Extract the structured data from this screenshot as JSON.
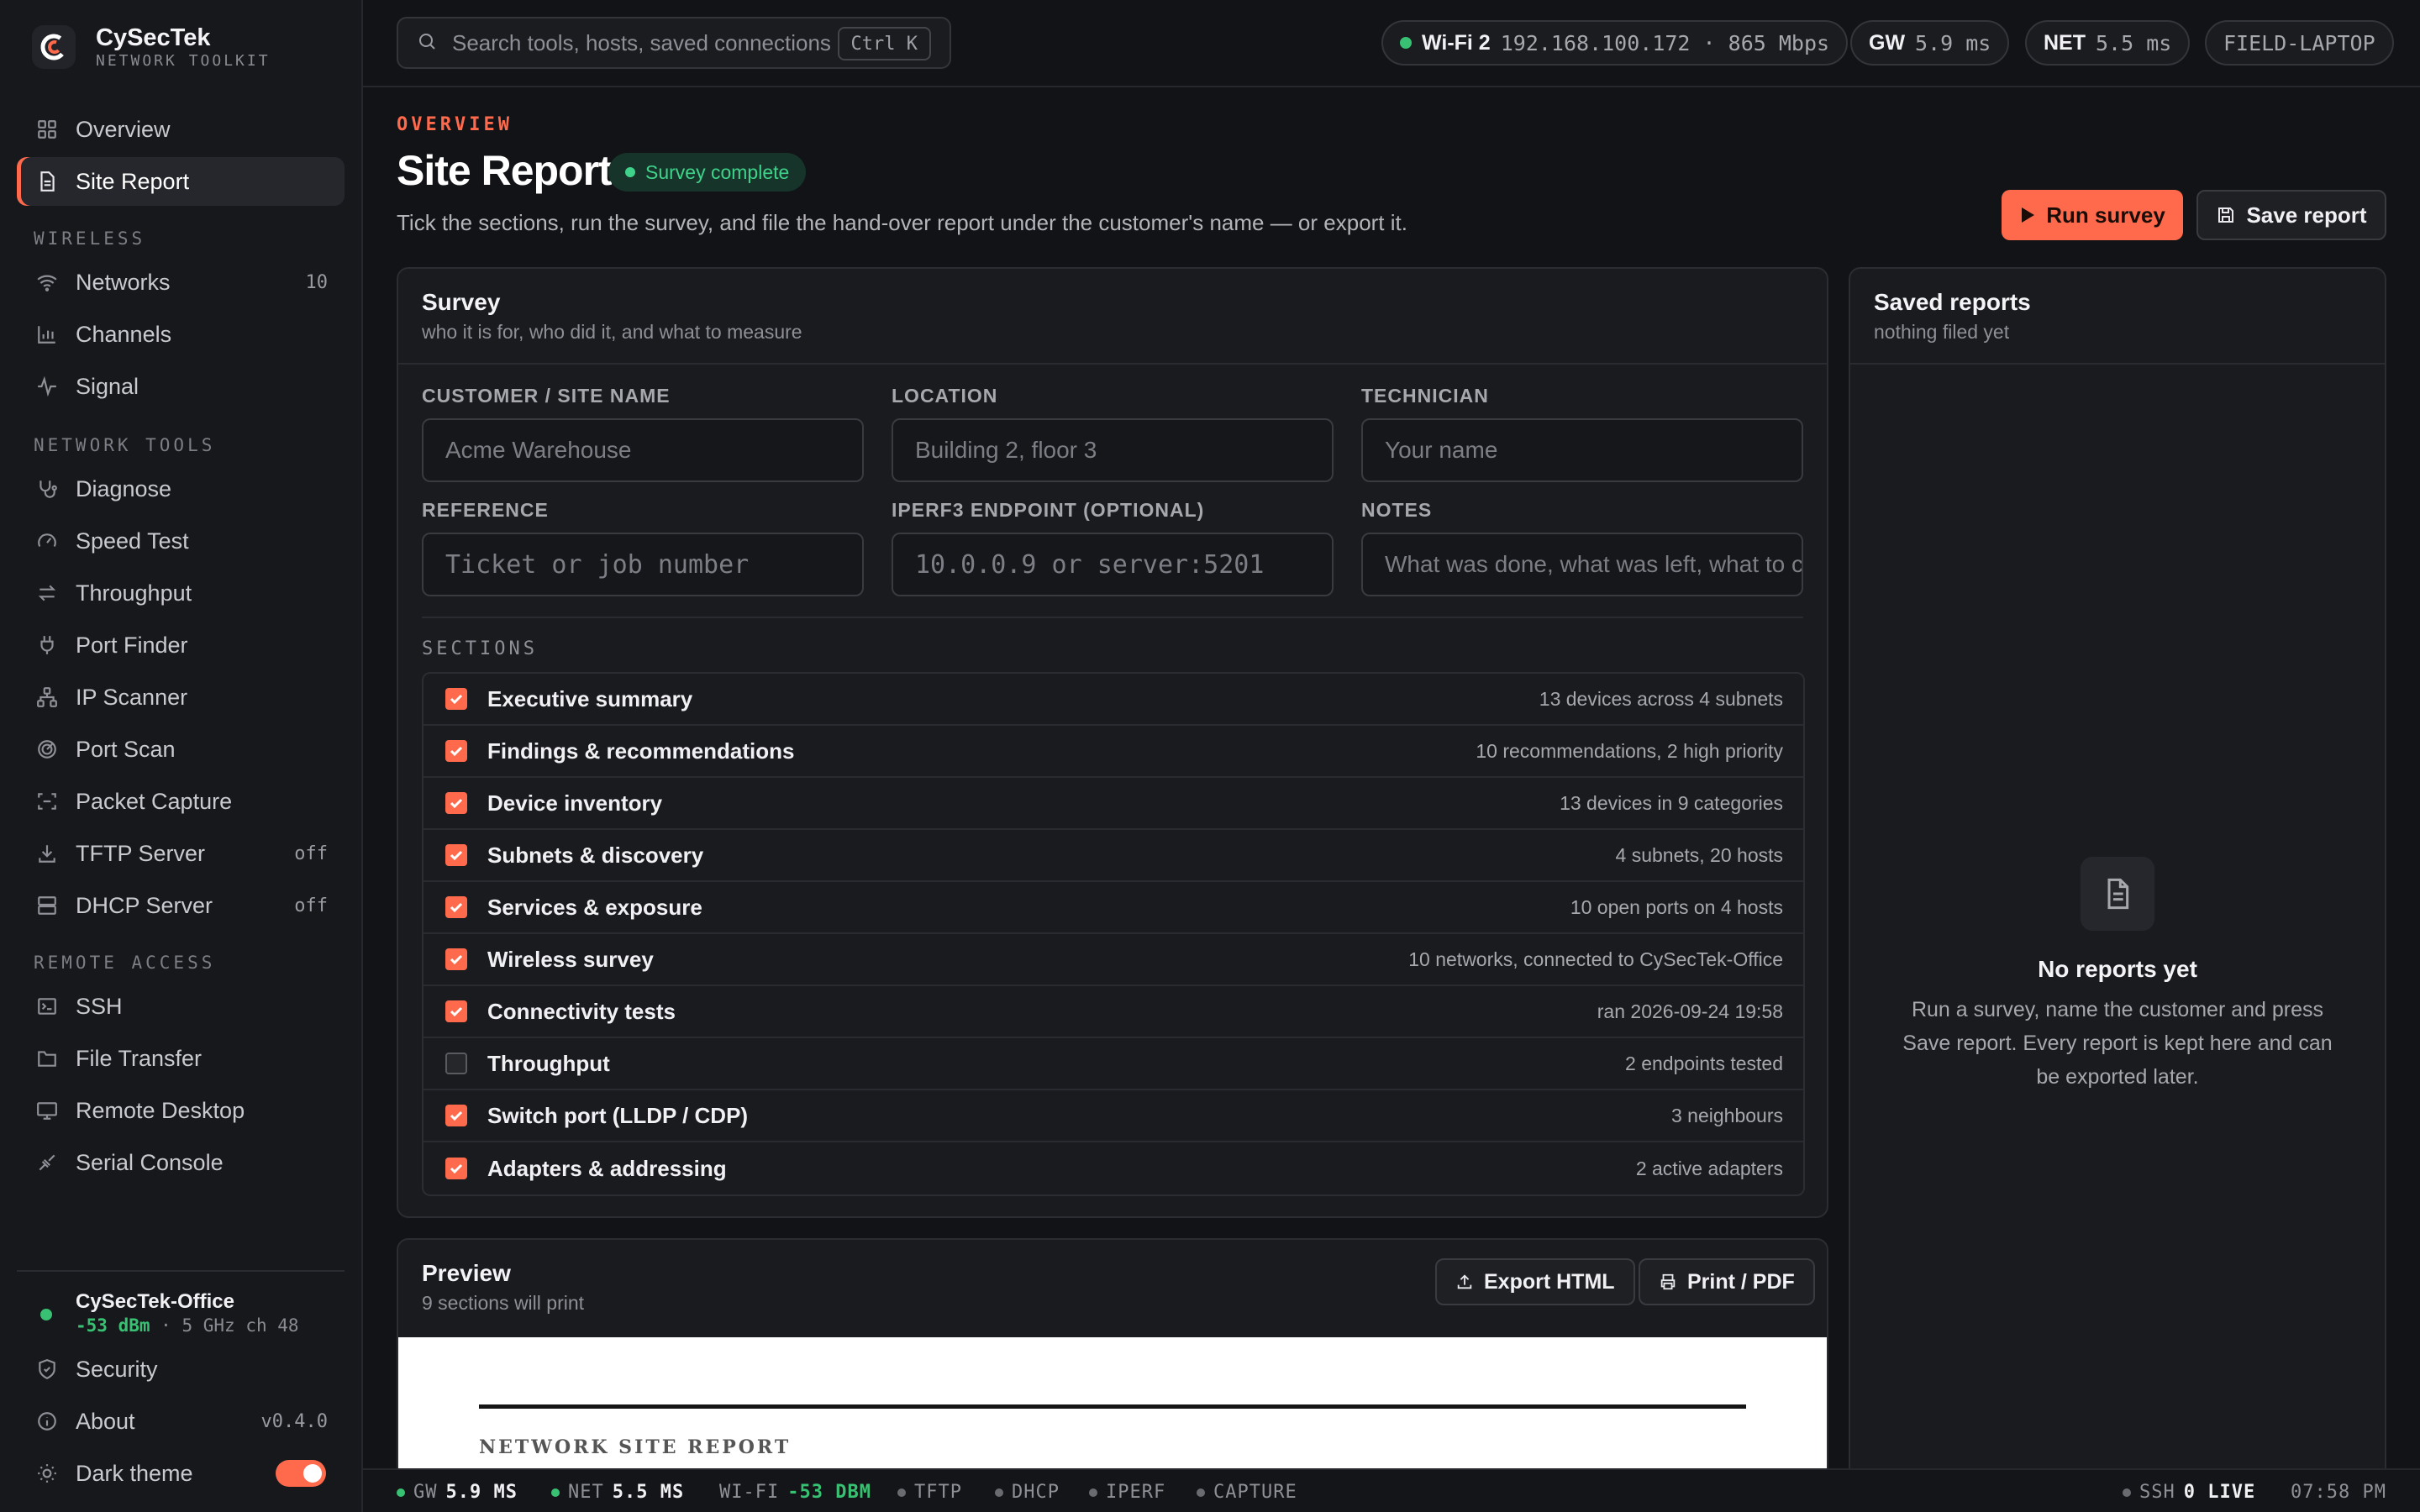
{
  "app": {
    "name": "CySecTek",
    "tagline": "NETWORK TOOLKIT"
  },
  "sidebar": {
    "items": [
      {
        "label": "Overview",
        "icon": "grid-icon"
      },
      {
        "label": "Site Report",
        "icon": "document-icon",
        "active": true
      }
    ],
    "sections": [
      {
        "title": "WIRELESS",
        "items": [
          {
            "label": "Networks",
            "icon": "wifi-icon",
            "badge": "10"
          },
          {
            "label": "Channels",
            "icon": "bar-chart-icon"
          },
          {
            "label": "Signal",
            "icon": "pulse-icon"
          }
        ]
      },
      {
        "title": "NETWORK TOOLS",
        "items": [
          {
            "label": "Diagnose",
            "icon": "stethoscope-icon"
          },
          {
            "label": "Speed Test",
            "icon": "gauge-icon"
          },
          {
            "label": "Throughput",
            "icon": "arrows-swap-icon"
          },
          {
            "label": "Port Finder",
            "icon": "plug-icon"
          },
          {
            "label": "IP Scanner",
            "icon": "network-icon"
          },
          {
            "label": "Port Scan",
            "icon": "radar-icon"
          },
          {
            "label": "Packet Capture",
            "icon": "capture-icon"
          },
          {
            "label": "TFTP Server",
            "icon": "download-icon",
            "badge": "off"
          },
          {
            "label": "DHCP Server",
            "icon": "server-icon",
            "badge": "off"
          }
        ]
      },
      {
        "title": "REMOTE ACCESS",
        "items": [
          {
            "label": "SSH",
            "icon": "terminal-icon"
          },
          {
            "label": "File Transfer",
            "icon": "folder-icon"
          },
          {
            "label": "Remote Desktop",
            "icon": "monitor-icon"
          },
          {
            "label": "Serial Console",
            "icon": "cable-icon"
          }
        ]
      }
    ],
    "connection": {
      "ssid": "CySecTek-Office",
      "signal": "-53 dBm",
      "band": "· 5 GHz ch 48"
    },
    "footer": [
      {
        "label": "Security",
        "icon": "shield-icon"
      },
      {
        "label": "About",
        "icon": "info-icon",
        "badge": "v0.4.0"
      },
      {
        "label": "Dark theme",
        "icon": "sun-icon",
        "toggle": true
      }
    ]
  },
  "topbar": {
    "search_placeholder": "Search tools, hosts, saved connections",
    "shortcut": "Ctrl K",
    "wifi": {
      "label": "Wi-Fi 2",
      "value": "192.168.100.172 · 865 Mbps"
    },
    "gw": {
      "label": "GW",
      "value": "5.9 ms"
    },
    "net": {
      "label": "NET",
      "value": "5.5 ms"
    },
    "host": "FIELD-LAPTOP"
  },
  "header": {
    "eyebrow": "OVERVIEW",
    "title": "Site Report",
    "badge": "Survey complete",
    "subtitle": "Tick the sections, run the survey, and file the hand-over report under the customer's name — or export it.",
    "run_label": "Run survey",
    "save_label": "Save report"
  },
  "survey": {
    "title": "Survey",
    "subtitle": "who it is for, who did it, and what to measure",
    "fields": {
      "customer": {
        "label": "CUSTOMER / SITE NAME",
        "placeholder": "Acme Warehouse"
      },
      "location": {
        "label": "LOCATION",
        "placeholder": "Building 2, floor 3"
      },
      "technician": {
        "label": "TECHNICIAN",
        "placeholder": "Your name"
      },
      "reference": {
        "label": "REFERENCE",
        "placeholder": "Ticket or job number"
      },
      "iperf": {
        "label": "IPERF3 ENDPOINT (OPTIONAL)",
        "placeholder": "10.0.0.9 or server:5201"
      },
      "notes": {
        "label": "NOTES",
        "placeholder": "What was done, what was left, what to chase"
      }
    },
    "sections_label": "SECTIONS",
    "sections": [
      {
        "name": "Executive summary",
        "meta": "13 devices across 4 subnets",
        "checked": true
      },
      {
        "name": "Findings & recommendations",
        "meta": "10 recommendations, 2 high priority",
        "checked": true
      },
      {
        "name": "Device inventory",
        "meta": "13 devices in 9 categories",
        "checked": true
      },
      {
        "name": "Subnets & discovery",
        "meta": "4 subnets, 20 hosts",
        "checked": true
      },
      {
        "name": "Services & exposure",
        "meta": "10 open ports on 4 hosts",
        "checked": true
      },
      {
        "name": "Wireless survey",
        "meta": "10 networks, connected to CySecTek-Office",
        "checked": true
      },
      {
        "name": "Connectivity tests",
        "meta": "ran 2026-09-24 19:58",
        "checked": true
      },
      {
        "name": "Throughput",
        "meta": "2 endpoints tested",
        "checked": false
      },
      {
        "name": "Switch port (LLDP / CDP)",
        "meta": "3 neighbours",
        "checked": true
      },
      {
        "name": "Adapters & addressing",
        "meta": "2 active adapters",
        "checked": true
      }
    ]
  },
  "preview": {
    "title": "Preview",
    "subtitle": "9 sections will print",
    "export_label": "Export HTML",
    "print_label": "Print / PDF",
    "doc_heading": "NETWORK SITE REPORT"
  },
  "saved": {
    "title": "Saved reports",
    "subtitle": "nothing filed yet",
    "empty_title": "No reports yet",
    "empty_text": "Run a survey, name the customer and press Save report. Every report is kept here and can be exported later."
  },
  "statusbar": {
    "gw_label": "GW",
    "gw_value": "5.9 MS",
    "net_label": "NET",
    "net_value": "5.5 MS",
    "wifi_label": "WI-FI",
    "wifi_value": "-53 DBM",
    "services": [
      "TFTP",
      "DHCP",
      "IPERF",
      "CAPTURE"
    ],
    "ssh_label": "SSH",
    "ssh_value": "0 LIVE",
    "time": "07:58 PM"
  },
  "colors": {
    "accent": "#ff6a4c",
    "success": "#38c172",
    "background": "#121316",
    "surface": "#1a1b1f"
  }
}
